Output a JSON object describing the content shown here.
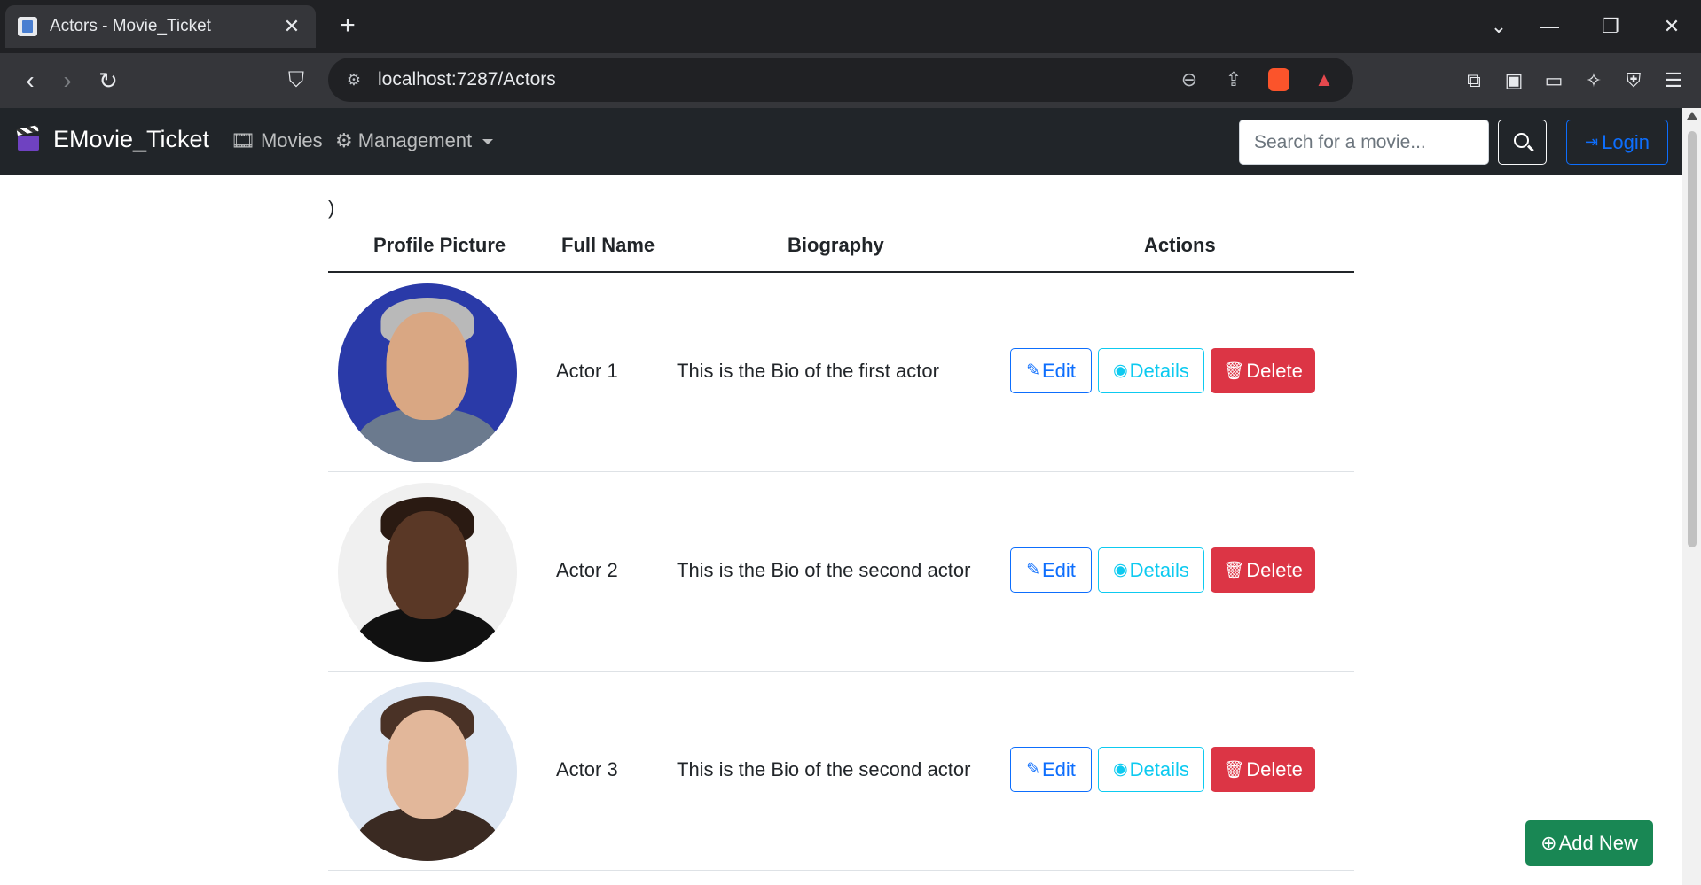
{
  "browser": {
    "tab_title": "Actors - Movie_Ticket",
    "tab_close": "✕",
    "new_tab": "+",
    "url": "localhost:7287/Actors",
    "window_buttons": {
      "tabs_dropdown": "⌄",
      "minimize": "—",
      "restore": "❐",
      "close": "✕"
    }
  },
  "navbar": {
    "brand": "EMovie_Ticket",
    "links": [
      {
        "label": "Movies",
        "icon": "film-icon"
      },
      {
        "label": "Management",
        "icon": "gear-icon"
      }
    ],
    "search_placeholder": "Search for a movie...",
    "login_label": "Login"
  },
  "stray_text": ")",
  "table": {
    "headers": [
      "Profile Picture",
      "Full Name",
      "Biography",
      "Actions"
    ],
    "rows": [
      {
        "name": "Actor 1",
        "bio": "This is the Bio of the first actor",
        "avatar_bg": "#2a3aa8",
        "skin": "#d9a783",
        "hair": "#b9b9b9",
        "clothes": "#6b7a8e"
      },
      {
        "name": "Actor 2",
        "bio": "This is the Bio of the second actor",
        "avatar_bg": "#f0f0f0",
        "skin": "#5a3826",
        "hair": "#2a1a12",
        "clothes": "#111111"
      },
      {
        "name": "Actor 3",
        "bio": "This is the Bio of the second actor",
        "avatar_bg": "#dde6f2",
        "skin": "#e2b79a",
        "hair": "#4a3226",
        "clothes": "#3a2a22"
      }
    ],
    "actions": {
      "edit": "Edit",
      "details": "Details",
      "delete": "Delete"
    }
  },
  "add_new_label": "Add New",
  "colors": {
    "primary": "#0d6efd",
    "info": "#0dcaf0",
    "danger": "#dc3545",
    "success": "#198754",
    "navbar": "#212529"
  }
}
